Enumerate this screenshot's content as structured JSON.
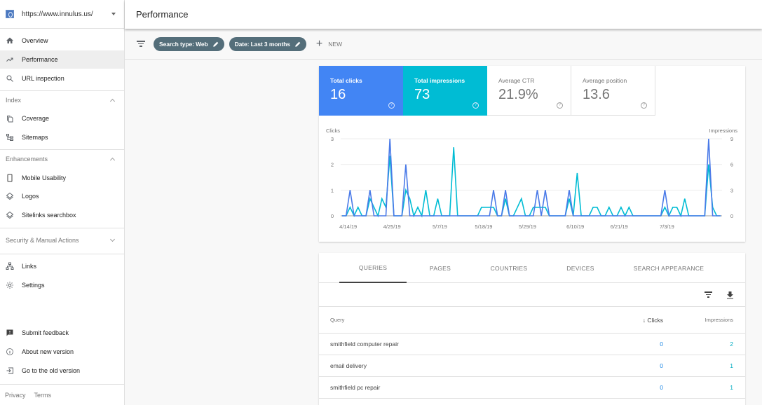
{
  "property": {
    "url": "https://www.innulus.us/"
  },
  "sidebar": {
    "top_items": [
      {
        "label": "Overview",
        "icon": "home-icon"
      },
      {
        "label": "Performance",
        "icon": "trending-up-icon",
        "active": true
      },
      {
        "label": "URL inspection",
        "icon": "search-icon"
      }
    ],
    "sections": [
      {
        "title": "Index",
        "expanded": true,
        "items": [
          {
            "label": "Coverage",
            "icon": "copy-icon"
          },
          {
            "label": "Sitemaps",
            "icon": "sitemap-icon"
          }
        ]
      },
      {
        "title": "Enhancements",
        "expanded": true,
        "items": [
          {
            "label": "Mobile Usability",
            "icon": "phone-icon"
          },
          {
            "label": "Logos",
            "icon": "layers-icon"
          },
          {
            "label": "Sitelinks searchbox",
            "icon": "layers-icon"
          }
        ]
      },
      {
        "title": "Security & Manual Actions",
        "expanded": false,
        "items": []
      }
    ],
    "other_items": [
      {
        "label": "Links",
        "icon": "links-icon"
      },
      {
        "label": "Settings",
        "icon": "gear-icon"
      }
    ],
    "bottom_items": [
      {
        "label": "Submit feedback",
        "icon": "feedback-icon"
      },
      {
        "label": "About new version",
        "icon": "info-icon"
      },
      {
        "label": "Go to the old version",
        "icon": "exit-icon"
      }
    ],
    "footer": {
      "privacy": "Privacy",
      "terms": "Terms"
    }
  },
  "header": {
    "title": "Performance"
  },
  "filters": {
    "chips": [
      "Search type: Web",
      "Date: Last 3 months"
    ],
    "new_label": "NEW"
  },
  "metrics": [
    {
      "label": "Total clicks",
      "value": "16",
      "selected": true,
      "color": "#4285f4"
    },
    {
      "label": "Total impressions",
      "value": "73",
      "selected": true,
      "color": "#00bcd4"
    },
    {
      "label": "Average CTR",
      "value": "21.9%",
      "selected": false
    },
    {
      "label": "Average position",
      "value": "13.6",
      "selected": false
    }
  ],
  "chart_data": {
    "type": "line",
    "xlabel": "",
    "ylabel_left": "Clicks",
    "ylabel_right": "Impressions",
    "y_left_range": [
      0,
      3
    ],
    "y_left_ticks": [
      0,
      1,
      2,
      3
    ],
    "y_right_range": [
      0,
      9
    ],
    "y_right_ticks": [
      0,
      3,
      6,
      9
    ],
    "x_tick_labels": [
      "4/14/19",
      "4/25/19",
      "5/7/19",
      "5/18/19",
      "5/29/19",
      "6/10/19",
      "6/21/19",
      "7/3/19"
    ],
    "x_tick_day_index": [
      1,
      12,
      24,
      35,
      46,
      58,
      69,
      81
    ],
    "start_date": "4/13/19",
    "grid": true,
    "legend": "none",
    "series": [
      {
        "name": "Clicks",
        "axis": "left",
        "color": "#4a7ae8",
        "values": [
          0,
          0,
          1,
          0,
          0,
          0,
          0,
          1,
          0,
          0,
          0,
          0,
          3,
          0,
          0,
          0,
          2,
          0,
          0,
          0,
          0,
          0,
          0,
          0,
          0,
          0,
          0,
          0,
          0,
          0,
          0,
          0,
          0,
          0,
          0,
          0,
          0,
          0,
          1,
          0,
          0,
          1,
          0,
          0,
          0,
          0,
          0,
          0,
          0,
          1,
          0,
          1,
          0,
          0,
          0,
          0,
          0,
          1,
          0,
          0,
          0,
          0,
          0,
          0,
          0,
          0,
          0,
          0,
          0,
          0,
          0,
          0,
          0,
          0,
          0,
          0,
          0,
          0,
          0,
          0,
          0,
          1,
          0,
          0,
          0,
          0,
          0,
          0,
          0,
          0,
          0,
          0,
          3,
          0,
          0,
          0
        ]
      },
      {
        "name": "Impressions",
        "axis": "right",
        "color": "#00bcd4",
        "values": [
          0,
          0,
          1,
          0,
          1,
          0,
          0,
          2,
          1,
          0,
          2,
          1,
          7,
          0,
          0,
          0,
          3,
          2,
          0,
          1,
          0,
          3,
          0,
          0,
          2,
          0,
          0,
          0,
          8,
          0,
          0,
          0,
          0,
          0,
          0,
          1,
          1,
          1,
          1,
          0,
          0,
          2,
          0,
          0,
          1,
          2,
          0,
          0,
          1,
          1,
          1,
          1,
          0,
          0,
          0,
          0,
          0,
          2,
          0,
          5,
          0,
          0,
          0,
          1,
          1,
          0,
          0,
          1,
          0,
          0,
          1,
          0,
          1,
          0,
          0,
          0,
          0,
          0,
          0,
          0,
          0,
          1,
          0,
          1,
          1,
          0,
          2,
          0,
          0,
          0,
          0,
          0,
          6,
          1,
          0,
          0
        ]
      }
    ]
  },
  "table": {
    "tabs": [
      {
        "label": "QUERIES",
        "active": true
      },
      {
        "label": "PAGES"
      },
      {
        "label": "COUNTRIES"
      },
      {
        "label": "DEVICES"
      },
      {
        "label": "SEARCH APPEARANCE"
      }
    ],
    "columns": {
      "query": "Query",
      "clicks": "Clicks",
      "impressions": "Impressions",
      "sort": "clicks-desc"
    },
    "rows": [
      {
        "query": "smithfield computer repair",
        "clicks": "0",
        "impressions": "2"
      },
      {
        "query": "email delivery",
        "clicks": "0",
        "impressions": "1"
      },
      {
        "query": "smithfield pc repair",
        "clicks": "0",
        "impressions": "1"
      }
    ]
  }
}
